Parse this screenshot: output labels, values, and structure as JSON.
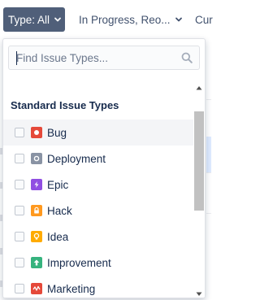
{
  "filter_bar": {
    "type_filter_label": "Type: All",
    "status_filter_label": "In Progress, Reo...",
    "more_filter_label": "Cur"
  },
  "dropdown": {
    "search": {
      "placeholder": "Find Issue Types...",
      "value": ""
    },
    "group_heading": "Standard Issue Types",
    "items": [
      {
        "label": "Bug",
        "icon": "bug-icon",
        "color": "#e5493a",
        "checked": false
      },
      {
        "label": "Deployment",
        "icon": "deployment-icon",
        "color": "#8993a4",
        "checked": false
      },
      {
        "label": "Epic",
        "icon": "epic-icon",
        "color": "#904ee2",
        "checked": false
      },
      {
        "label": "Hack",
        "icon": "hack-icon",
        "color": "#ff991f",
        "checked": false
      },
      {
        "label": "Idea",
        "icon": "idea-icon",
        "color": "#ffab00",
        "checked": false
      },
      {
        "label": "Improvement",
        "icon": "improvement-icon",
        "color": "#36b37e",
        "checked": false
      },
      {
        "label": "Marketing",
        "icon": "marketing-icon",
        "color": "#e5493a",
        "checked": false
      }
    ]
  },
  "colors": {
    "active_filter_bg": "#505f79",
    "hover_row_bg": "#f4f5f7",
    "text": "#172b4d"
  }
}
